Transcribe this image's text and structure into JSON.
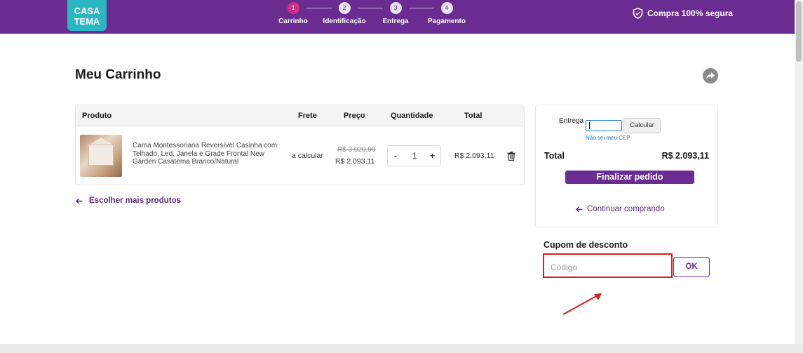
{
  "brand": {
    "line1": "CASA",
    "line2": "TEMA",
    "color": "#2bb6c4"
  },
  "header": {
    "background": "#6a2c91",
    "steps": [
      {
        "number": "1",
        "label": "Carrinho",
        "active": true
      },
      {
        "number": "2",
        "label": "Identificação",
        "active": false
      },
      {
        "number": "3",
        "label": "Entrega",
        "active": false
      },
      {
        "number": "4",
        "label": "Pagamento",
        "active": false
      }
    ],
    "secure_text": "Compra 100% segura",
    "secure_icon": "shield-check-icon"
  },
  "page": {
    "title": "Meu Carrinho",
    "share_icon": "share-arrow-icon"
  },
  "cart": {
    "columns": {
      "product": "Produto",
      "shipping": "Frete",
      "price": "Preço",
      "quantity": "Quantidade",
      "total": "Total"
    },
    "items": [
      {
        "name": "Cama Montessoriana Reversível Casinha com Telhado, Led, Janela e Grade Frontal New Garden Casatema Branco/Natural",
        "shipping": "a calcular",
        "old_price": "R$ 3.020,99",
        "price": "R$ 2.093,11",
        "qty_minus": "-",
        "quantity": "1",
        "qty_plus": "+",
        "total": "R$ 2.093,11",
        "delete_icon": "trash-icon"
      }
    ],
    "more_products": "Escolher mais produtos"
  },
  "summary": {
    "delivery_label": "Entrega",
    "cep_value": "",
    "calculate_button": "Calcular",
    "no_cep_link": "Não sei meu CEP",
    "total_label": "Total",
    "total_value": "R$ 2.093,11",
    "checkout_button": "Finalizar pedido",
    "continue_link": "Continuar comprando"
  },
  "coupon": {
    "title": "Cupom de desconto",
    "placeholder": "Código",
    "ok_button": "OK",
    "highlight_color": "#d81e1e"
  }
}
